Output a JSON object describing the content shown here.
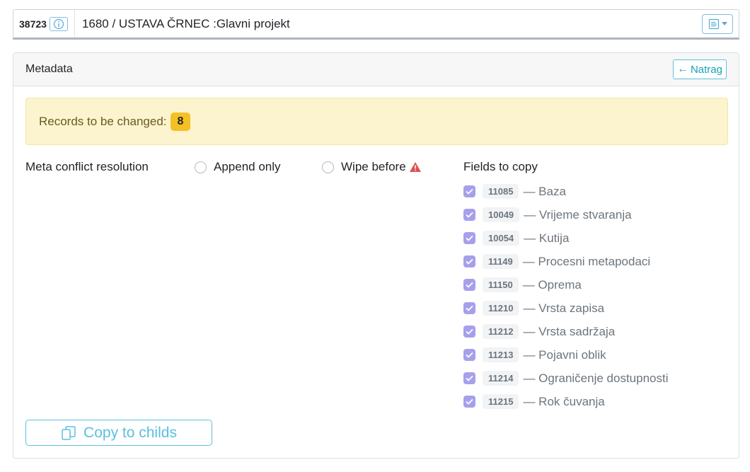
{
  "header": {
    "record_id": "38723",
    "title": "1680 / USTAVA ČRNEC :Glavni projekt"
  },
  "card": {
    "title": "Metadata",
    "back_label": "Natrag"
  },
  "alert": {
    "label": "Records to be changed:",
    "count": "8"
  },
  "conflict": {
    "label": "Meta conflict resolution",
    "options": [
      {
        "label": "Append only",
        "selected": false
      },
      {
        "label": "Wipe before",
        "selected": false
      }
    ]
  },
  "fields": {
    "label": "Fields to copy",
    "items": [
      {
        "code": "11085",
        "name": "— Baza",
        "checked": true
      },
      {
        "code": "10049",
        "name": "— Vrijeme stvaranja",
        "checked": true
      },
      {
        "code": "10054",
        "name": "— Kutija",
        "checked": true
      },
      {
        "code": "11149",
        "name": "— Procesni metapodaci",
        "checked": true
      },
      {
        "code": "11150",
        "name": "— Oprema",
        "checked": true
      },
      {
        "code": "11210",
        "name": "— Vrsta zapisa",
        "checked": true
      },
      {
        "code": "11212",
        "name": "— Vrsta sadržaja",
        "checked": true
      },
      {
        "code": "11213",
        "name": "— Pojavni oblik",
        "checked": true
      },
      {
        "code": "11214",
        "name": "— Ograničenje dostupnosti",
        "checked": true
      },
      {
        "code": "11215",
        "name": "— Rok čuvanja",
        "checked": true
      }
    ]
  },
  "actions": {
    "copy_label": "Copy to childs"
  },
  "colors": {
    "accent": "#5bc0de",
    "checkbox": "#a6a0ec",
    "alert_bg": "#fbf4cf",
    "badge": "#f4c025",
    "warning": "#d9534f"
  }
}
